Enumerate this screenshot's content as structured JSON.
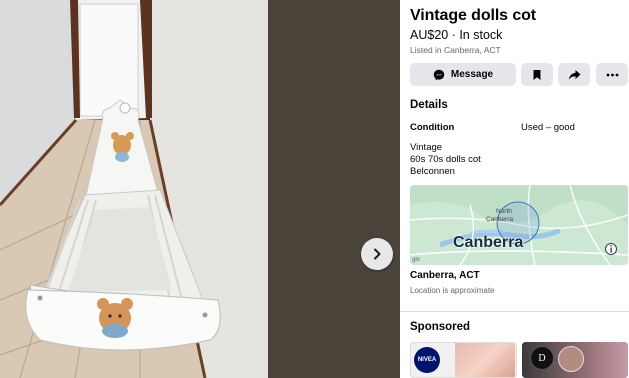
{
  "listing": {
    "title": "Vintage dolls cot",
    "price_status": "AU$20 · In stock",
    "listed": "Listed in Canberra, ACT"
  },
  "actions": {
    "message_label": "Message",
    "save_icon": "bookmark-icon",
    "share_icon": "share-icon",
    "more_icon": "more-icon"
  },
  "details": {
    "heading": "Details",
    "condition_label": "Condition",
    "condition_value": "Used – good",
    "description": [
      "Vintage",
      "60s  70s dolls cot",
      "Belconnen"
    ]
  },
  "map": {
    "city_label": "Canberra",
    "area_label": "North Canberra",
    "attribution": "glo"
  },
  "location": {
    "name": "Canberra, ACT",
    "note": "Location is approximate"
  },
  "sponsored": {
    "heading": "Sponsored",
    "ads": [
      {
        "badge": "NIVEA",
        "brand_color": "#00136f"
      },
      {
        "badge": "D"
      }
    ]
  },
  "viewer": {
    "next_icon": "chevron-right-icon"
  }
}
